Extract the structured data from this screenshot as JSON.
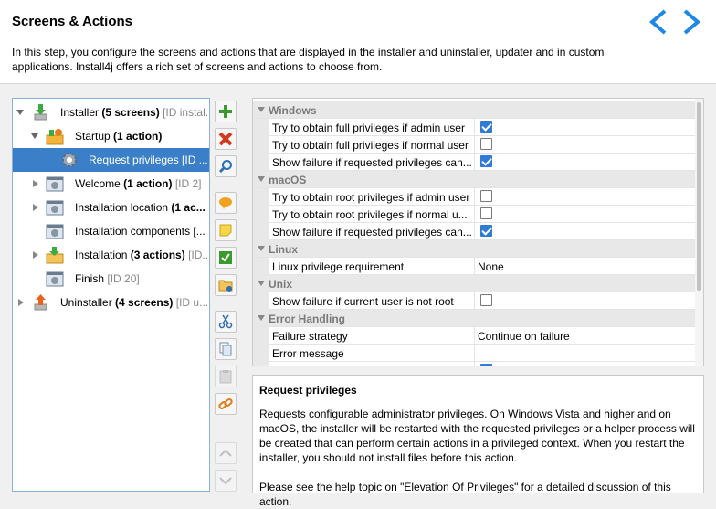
{
  "header": {
    "title": "Screens & Actions",
    "description": "In this step, you configure the screens and actions that are displayed in the installer and uninstaller, updater and in custom applications. Install4j offers a rich set of screens and actions to choose from."
  },
  "colors": {
    "accent": "#1e88e5",
    "selection": "#3a7fc7",
    "check": "#2f7bd6"
  },
  "tree": {
    "items": [
      {
        "label": "Installer",
        "bold": "(5 screens)",
        "id": "[ID instal...",
        "icon": "installer-icon"
      },
      {
        "label": "Startup",
        "bold": "(1 action)",
        "id": "",
        "icon": "startup-icon"
      },
      {
        "label": "Request privileges [ID ...",
        "bold": "",
        "id": "",
        "icon": "gear-icon"
      },
      {
        "label": "Welcome",
        "bold": "(1 action)",
        "id": "[ID 2]",
        "icon": "screen-icon"
      },
      {
        "label": "Installation location",
        "bold": "(1 ac...",
        "id": "",
        "icon": "screen-icon"
      },
      {
        "label": "Installation components [...",
        "bold": "",
        "id": "",
        "icon": "screen-icon"
      },
      {
        "label": "Installation",
        "bold": "(3 actions)",
        "id": "[ID...",
        "icon": "installation-icon"
      },
      {
        "label": "Finish",
        "bold": "",
        "id": "[ID 20]",
        "icon": "screen-icon"
      },
      {
        "label": "Uninstaller",
        "bold": "(4 screens)",
        "id": "[ID u...",
        "icon": "uninstaller-icon"
      }
    ]
  },
  "toolbar": {
    "buttons": [
      "add",
      "delete",
      "search",
      "comment",
      "note",
      "check",
      "folder",
      "cut",
      "copy",
      "paste",
      "link",
      "move-up",
      "move-down"
    ]
  },
  "properties": {
    "windows": {
      "category": "Windows",
      "admin": "Try to obtain full privileges if admin user",
      "normal": "Try to obtain full privileges if normal user",
      "failure": "Show failure if requested privileges can..."
    },
    "macos": {
      "category": "macOS",
      "admin": "Try to obtain root privileges if admin user",
      "normal": "Try to obtain root privileges if normal u...",
      "failure": "Show failure if requested privileges can..."
    },
    "linux": {
      "category": "Linux",
      "requirement": "Linux privilege requirement",
      "requirement_value": "None"
    },
    "unix": {
      "category": "Unix",
      "failure": "Show failure if current user is not root"
    },
    "error": {
      "category": "Error Handling",
      "strategy": "Failure strategy",
      "strategy_value": "Continue on failure",
      "message": "Error message"
    }
  },
  "help": {
    "title": "Request privileges",
    "body": "Requests configurable administrator privileges. On Windows Vista and higher and on macOS, the installer will be restarted with the requested privileges or a helper process will be created that can perform certain actions in a privileged context. When you restart the installer, you should not install files before this action.",
    "footer": "Please see the help topic on \"Elevation Of Privileges\" for a detailed discussion of this action."
  }
}
